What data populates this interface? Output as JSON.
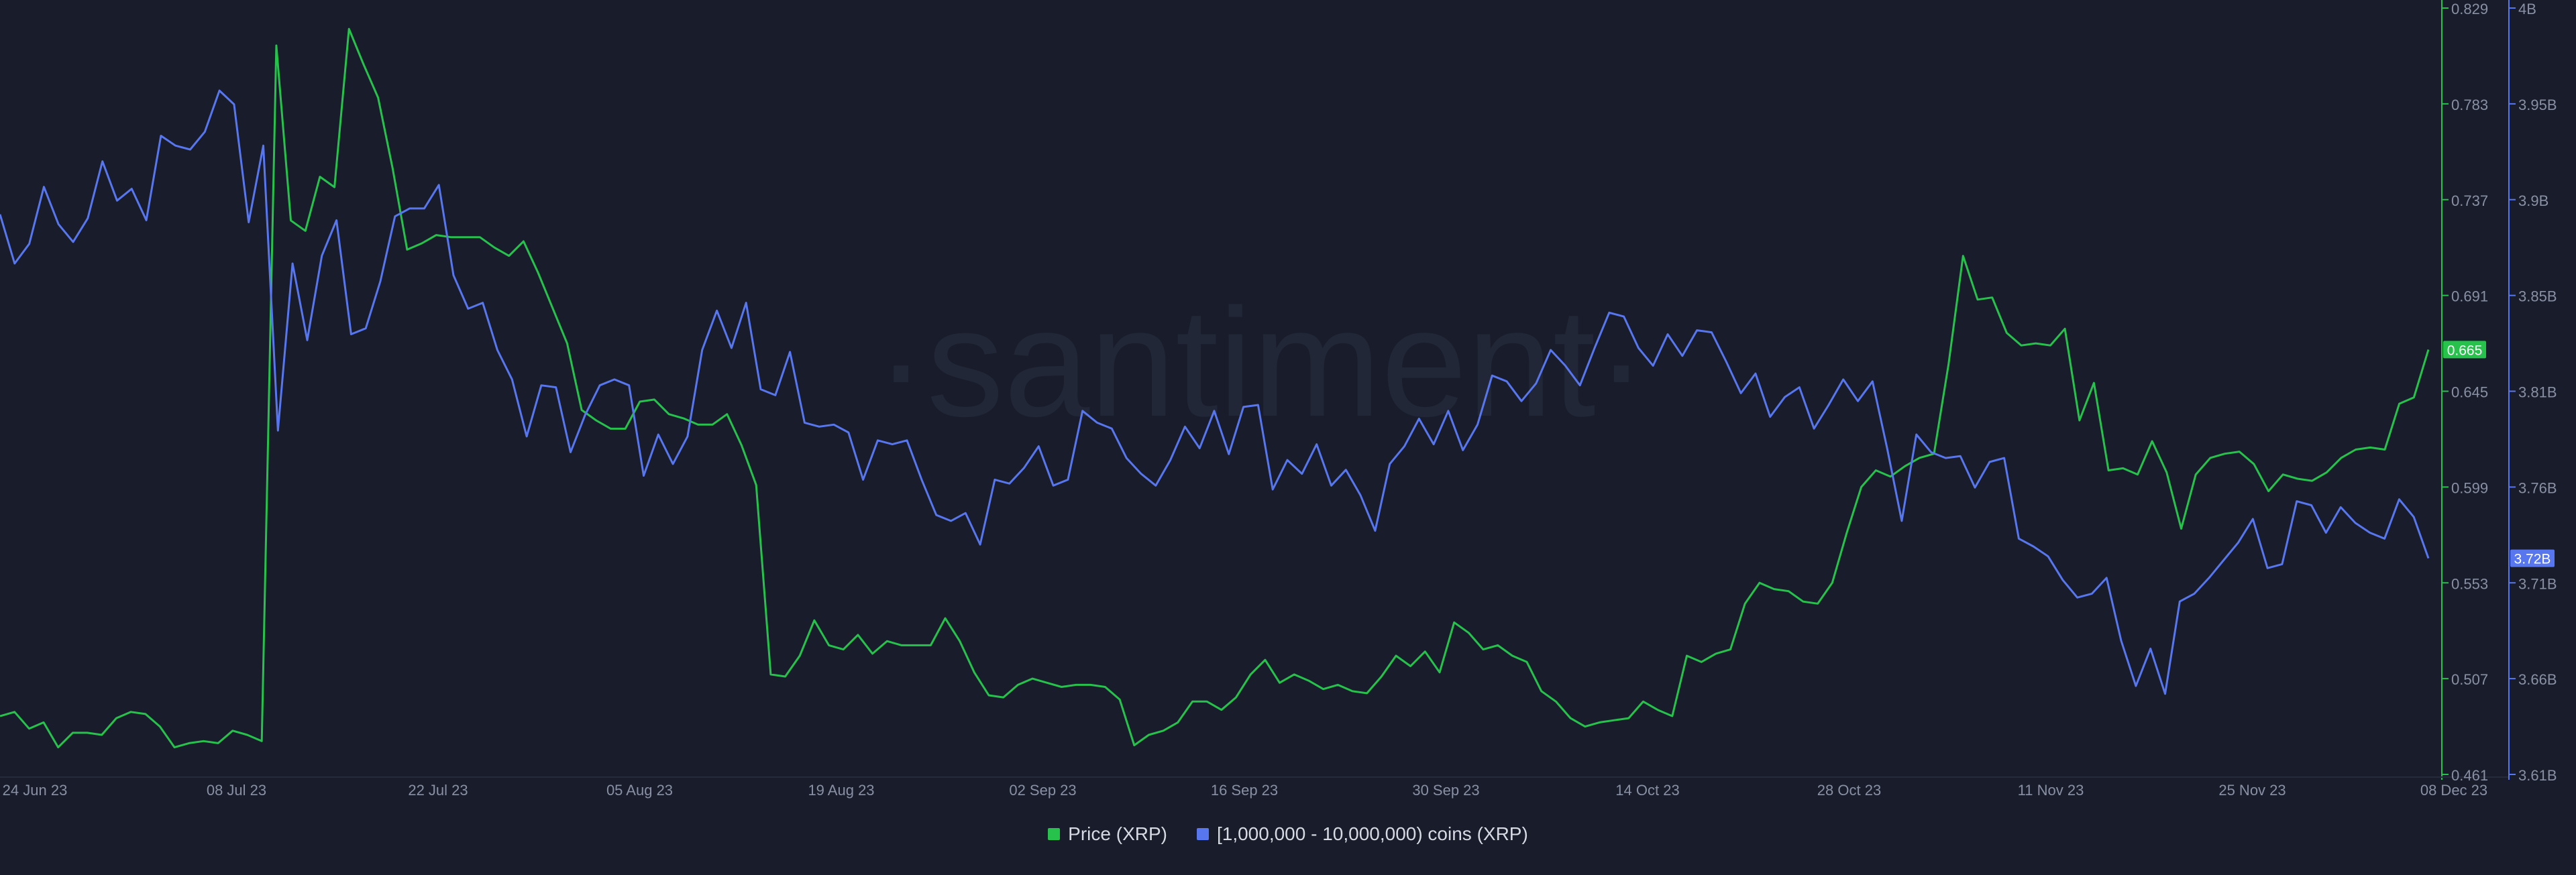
{
  "watermark": "·santiment·",
  "colors": {
    "background": "#181c2b",
    "price": "#27c24c",
    "holders": "#5877ef",
    "tick": "#8a90a3",
    "watermark": "#222737"
  },
  "legend": [
    {
      "label": "Price (XRP)",
      "color": "#27c24c"
    },
    {
      "label": "[1,000,000 - 10,000,000) coins (XRP)",
      "color": "#5877ef"
    }
  ],
  "chart_data": {
    "type": "line",
    "title": "",
    "grid": false,
    "legend_position": "bottom-center",
    "x_ticks": [
      "24 Jun 23",
      "08 Jul 23",
      "22 Jul 23",
      "05 Aug 23",
      "19 Aug 23",
      "02 Sep 23",
      "16 Sep 23",
      "30 Sep 23",
      "14 Oct 23",
      "28 Oct 23",
      "11 Nov 23",
      "25 Nov 23",
      "08 Dec 23"
    ],
    "y_left": {
      "ticks": [
        "0.829",
        "0.783",
        "0.737",
        "0.691",
        "0.645",
        "0.599",
        "0.553",
        "0.507",
        "0.461"
      ],
      "range": [
        0.461,
        0.829
      ],
      "current_label": "0.665"
    },
    "y_right": {
      "ticks": [
        "4B",
        "3.95B",
        "3.9B",
        "3.85B",
        "3.81B",
        "3.76B",
        "3.71B",
        "3.66B",
        "3.61B"
      ],
      "range": [
        3.61,
        4.0
      ],
      "unit": "B",
      "current_label": "3.72B"
    },
    "series": [
      {
        "name": "Price (XRP)",
        "axis": "left",
        "values": [
          0.489,
          0.491,
          0.483,
          0.486,
          0.474,
          0.481,
          0.481,
          0.48,
          0.488,
          0.491,
          0.49,
          0.484,
          0.474,
          0.476,
          0.477,
          0.476,
          0.482,
          0.48,
          0.477,
          0.811,
          0.727,
          0.722,
          0.748,
          0.743,
          0.819,
          0.802,
          0.786,
          0.752,
          0.713,
          0.716,
          0.72,
          0.719,
          0.719,
          0.719,
          0.714,
          0.71,
          0.717,
          0.702,
          0.685,
          0.668,
          0.636,
          0.631,
          0.627,
          0.627,
          0.64,
          0.641,
          0.634,
          0.632,
          0.629,
          0.629,
          0.634,
          0.619,
          0.6,
          0.509,
          0.508,
          0.518,
          0.535,
          0.523,
          0.521,
          0.528,
          0.519,
          0.525,
          0.523,
          0.523,
          0.523,
          0.536,
          0.525,
          0.51,
          0.499,
          0.498,
          0.504,
          0.507,
          0.505,
          0.503,
          0.504,
          0.504,
          0.503,
          0.497,
          0.475,
          0.48,
          0.482,
          0.486,
          0.496,
          0.496,
          0.492,
          0.498,
          0.509,
          0.516,
          0.505,
          0.509,
          0.506,
          0.502,
          0.504,
          0.501,
          0.5,
          0.508,
          0.518,
          0.513,
          0.52,
          0.51,
          0.534,
          0.529,
          0.521,
          0.523,
          0.518,
          0.515,
          0.501,
          0.496,
          0.488,
          0.484,
          0.486,
          0.487,
          0.488,
          0.496,
          0.492,
          0.489,
          0.518,
          0.515,
          0.519,
          0.521,
          0.543,
          0.553,
          0.55,
          0.549,
          0.544,
          0.543,
          0.553,
          0.577,
          0.599,
          0.607,
          0.604,
          0.609,
          0.613,
          0.615,
          0.658,
          0.71,
          0.689,
          0.69,
          0.673,
          0.667,
          0.668,
          0.667,
          0.675,
          0.631,
          0.649,
          0.607,
          0.608,
          0.605,
          0.621,
          0.606,
          0.579,
          0.605,
          0.613,
          0.615,
          0.616,
          0.61,
          0.597,
          0.605,
          0.603,
          0.602,
          0.606,
          0.613,
          0.617,
          0.618,
          0.617,
          0.639,
          0.642,
          0.665
        ]
      },
      {
        "name": "[1,000,000 - 10,000,000) coins (XRP)",
        "axis": "right",
        "values": [
          3.895,
          3.87,
          3.88,
          3.909,
          3.89,
          3.881,
          3.893,
          3.922,
          3.902,
          3.908,
          3.892,
          3.935,
          3.93,
          3.928,
          3.937,
          3.958,
          3.951,
          3.891,
          3.93,
          3.785,
          3.87,
          3.831,
          3.874,
          3.892,
          3.834,
          3.837,
          3.861,
          3.894,
          3.898,
          3.898,
          3.91,
          3.864,
          3.847,
          3.85,
          3.826,
          3.811,
          3.782,
          3.808,
          3.807,
          3.774,
          3.793,
          3.808,
          3.811,
          3.808,
          3.762,
          3.783,
          3.768,
          3.782,
          3.826,
          3.846,
          3.827,
          3.85,
          3.806,
          3.803,
          3.825,
          3.789,
          3.787,
          3.788,
          3.784,
          3.76,
          3.78,
          3.778,
          3.78,
          3.76,
          3.742,
          3.739,
          3.743,
          3.727,
          3.76,
          3.758,
          3.766,
          3.777,
          3.757,
          3.76,
          3.795,
          3.789,
          3.786,
          3.771,
          3.763,
          3.757,
          3.77,
          3.787,
          3.776,
          3.795,
          3.773,
          3.797,
          3.798,
          3.755,
          3.77,
          3.763,
          3.778,
          3.757,
          3.765,
          3.752,
          3.734,
          3.768,
          3.777,
          3.791,
          3.778,
          3.795,
          3.775,
          3.788,
          3.813,
          3.81,
          3.8,
          3.809,
          3.826,
          3.818,
          3.808,
          3.827,
          3.845,
          3.843,
          3.827,
          3.818,
          3.834,
          3.823,
          3.836,
          3.835,
          3.82,
          3.804,
          3.814,
          3.792,
          3.802,
          3.807,
          3.786,
          3.798,
          3.811,
          3.8,
          3.81,
          3.776,
          3.739,
          3.783,
          3.774,
          3.771,
          3.772,
          3.756,
          3.769,
          3.771,
          3.73,
          3.726,
          3.721,
          3.709,
          3.7,
          3.702,
          3.71,
          3.678,
          3.655,
          3.674,
          3.651,
          3.698,
          3.702,
          3.71,
          3.719,
          3.728,
          3.74,
          3.715,
          3.717,
          3.749,
          3.747,
          3.733,
          3.746,
          3.738,
          3.733,
          3.73,
          3.75,
          3.741,
          3.72
        ]
      }
    ]
  }
}
